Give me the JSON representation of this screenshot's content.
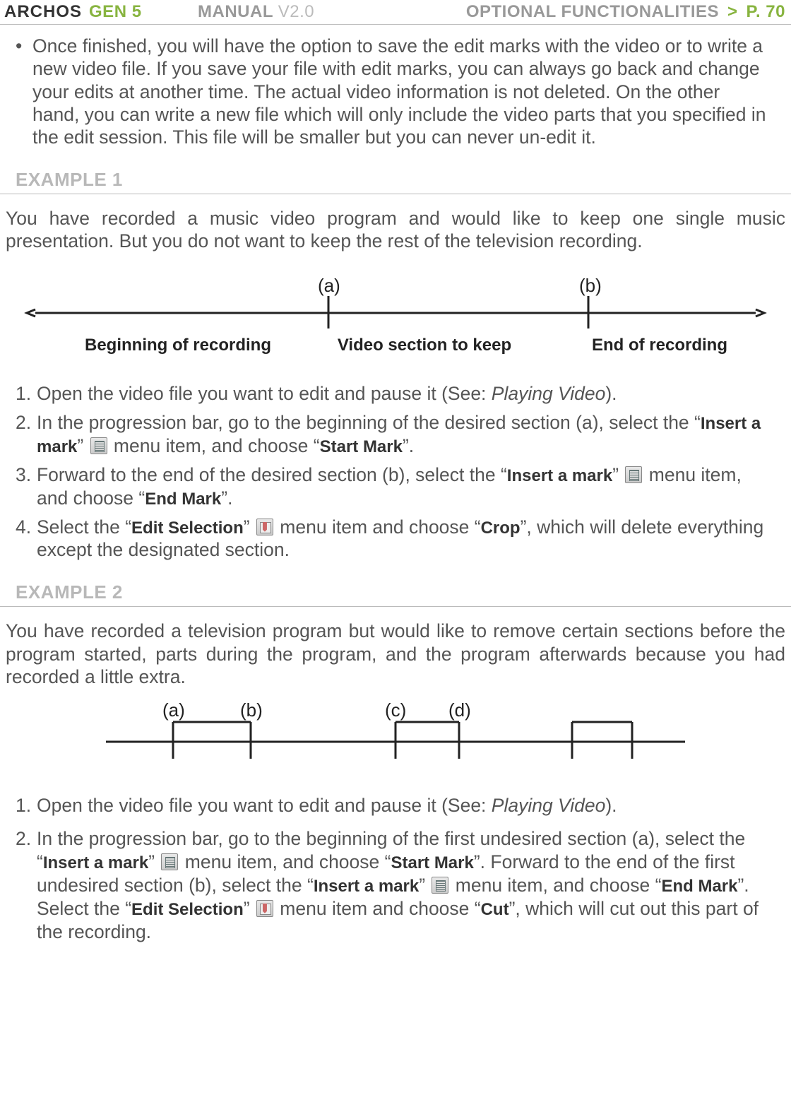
{
  "header": {
    "brand": "ARCHOS",
    "gen": "GEN 5",
    "manual": "MANUAL",
    "version": "V2.0",
    "section": "OPTIONAL FUNCTIONALITIES",
    "sep": ">",
    "page": "P. 70"
  },
  "intro_bullet": "Once finished, you will have the option to save the edit marks with the video or to write a new video file. If you save your file with edit marks, you can always go back and change your edits at another time. The actual video information is not deleted. On the other hand, you can write a new file which will only include the video parts that you specified in the edit session. This file will be smaller but you can never un-edit it.",
  "example1": {
    "title": "EXAMPLE 1",
    "intro": "You have recorded a music video program and would like to keep one single music presentation.  But you do not want to keep the rest of the television recording.",
    "timeline": {
      "marker_a": "(a)",
      "marker_b": "(b)",
      "label_left": "Beginning of recording",
      "label_mid": "Video section to keep",
      "label_right": "End of recording"
    },
    "steps": {
      "s1_a": "Open the video file you want to edit and pause it (See: ",
      "s1_b": "Playing Video",
      "s1_c": ").",
      "s2_a": "In the progression bar, go to the beginning of the desired section (a), select the “",
      "s2_b": "Insert a mark",
      "s2_c": "” ",
      "s2_d": " menu item, and choose “",
      "s2_e": "Start Mark",
      "s2_f": "”.",
      "s3_a": "Forward to the end of the desired section (b), select the “",
      "s3_b": "Insert a mark",
      "s3_c": "” ",
      "s3_d": " menu item, and choose “",
      "s3_e": "End Mark",
      "s3_f": "”.",
      "s4_a": "Select the “",
      "s4_b": "Edit Selection",
      "s4_c": "” ",
      "s4_d": " menu item and choose “",
      "s4_e": "Crop",
      "s4_f": "”, which will delete everything except the designated section."
    }
  },
  "example2": {
    "title": "EXAMPLE 2",
    "intro": "You have recorded a television program but would like to remove certain sections before the program started, parts during the program, and the program afterwards because you had recorded a little extra.",
    "markers": {
      "a": "(a)",
      "b": "(b)",
      "c": "(c)",
      "d": "(d)"
    },
    "steps": {
      "s1_a": "Open the video file you want to edit and pause it (See: ",
      "s1_b": "Playing Video",
      "s1_c": ").",
      "s2_a": "In the progression bar, go to the beginning of the first undesired section (a), select the “",
      "s2_b": "Insert a mark",
      "s2_c": "” ",
      "s2_d": " menu item, and choose “",
      "s2_e": "Start Mark",
      "s2_f": "”. Forward to the end of the first undesired section (b), select the “",
      "s2_g": "Insert a mark",
      "s2_h": "” ",
      "s2_i": " menu item, and choose “",
      "s2_j": "End Mark",
      "s2_k": "”. Select the “",
      "s2_l": "Edit Selection",
      "s2_m": "” ",
      "s2_n": " menu item and choose “",
      "s2_o": "Cut",
      "s2_p": "”, which will cut out this part of the recording."
    }
  }
}
